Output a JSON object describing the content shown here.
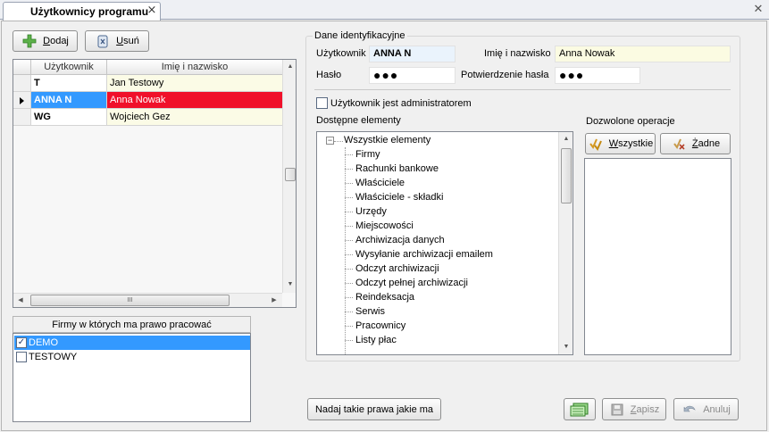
{
  "tab": {
    "title": "Użytkownicy programu"
  },
  "toolbar": {
    "add_accel": "D",
    "add_rest": "odaj",
    "remove_accel": "U",
    "remove_rest": "suń"
  },
  "users_grid": {
    "columns": [
      "Użytkownik",
      "Imię i nazwisko"
    ],
    "rows": [
      {
        "login": "T",
        "name": "Jan Testowy"
      },
      {
        "login": "ANNA N",
        "name": "Anna Nowak"
      },
      {
        "login": "WG",
        "name": "Wojciech Gez"
      }
    ],
    "selected_index": 1
  },
  "firms": {
    "title": "Firmy w których ma prawo pracować",
    "items": [
      {
        "label": "DEMO",
        "checked": true
      },
      {
        "label": "TESTOWY",
        "checked": false
      }
    ]
  },
  "identity": {
    "group_title": "Dane identyfikacyjne",
    "user_label": "Użytkownik",
    "user_value": "ANNA N",
    "name_label": "Imię i nazwisko",
    "name_value": "Anna Nowak",
    "password_label": "Hasło",
    "password_value": "●●●",
    "confirm_label": "Potwierdzenie hasła",
    "confirm_value": "●●●"
  },
  "admin_checkbox": {
    "label": "Użytkownik jest administratorem",
    "checked": false
  },
  "available": {
    "title": "Dostępne elementy",
    "root": "Wszystkie elementy",
    "items": [
      "Firmy",
      "Rachunki bankowe",
      "Właściciele",
      "Właściciele - składki",
      "Urzędy",
      "Miejscowości",
      "Archiwizacja danych",
      "Wysyłanie archiwizacji emailem",
      "Odczyt archiwizacji",
      "Odczyt pełnej archiwizacji",
      "Reindeksacja",
      "Serwis",
      "Pracownicy",
      "Listy płac"
    ]
  },
  "allowed": {
    "title": "Dozwolone operacje",
    "all_accel": "W",
    "all_rest": "szystkie",
    "none_accel": "Ż",
    "none_rest": "adne"
  },
  "footer": {
    "copy_rights_label": "Nadaj takie prawa jakie ma",
    "save_accel": "Z",
    "save_rest": "apisz",
    "cancel_label": "Anuluj"
  },
  "scrollbar_glyph": "III"
}
